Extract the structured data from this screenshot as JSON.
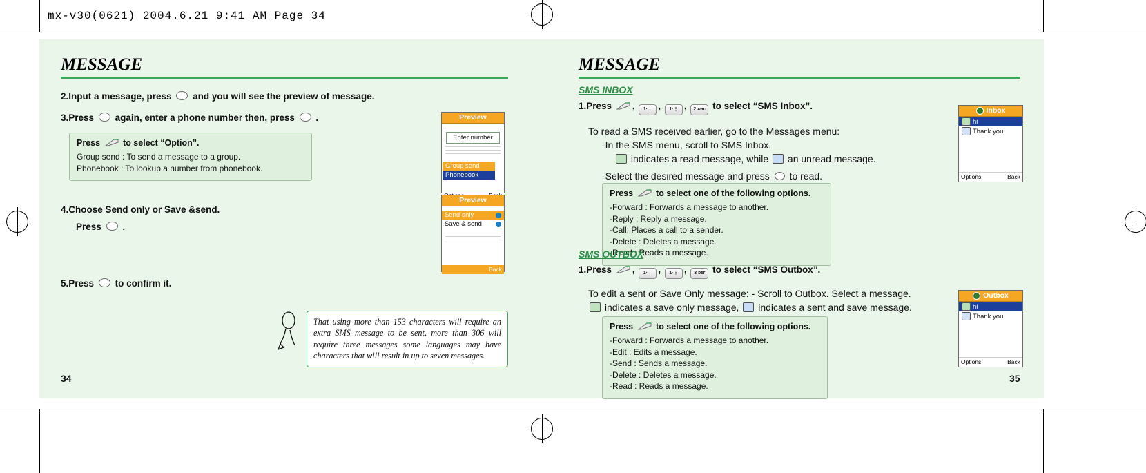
{
  "header": {
    "filestamp": "mx-v30(0621)  2004.6.21  9:41 AM  Page 34"
  },
  "left_page": {
    "title": "MESSAGE",
    "page_number": "34",
    "steps": [
      {
        "id": "step2",
        "text_before": "2.Input a message, press",
        "text_after": "and you will see the preview of message."
      },
      {
        "id": "step3",
        "text_before": "3.Press",
        "text_mid": "again, enter a phone number then, press",
        "text_after": "."
      }
    ],
    "option_box": {
      "press_label": "Press",
      "press_suffix": "to select “Option”.",
      "lines": [
        "Group send : To send a message to a group.",
        "Phonebook : To lookup a number from phonebook."
      ]
    },
    "step4": {
      "line1": "4.Choose Send only or Save &send.",
      "line2": "Press",
      "line2_after": "."
    },
    "step5": {
      "before": "5.Press",
      "after": "to confirm it."
    },
    "tip": "That using more than 153 characters will require an extra SMS message to be sent, more than 306 will require three messages some languages may have characters that will result in up to seven messages.",
    "phone1": {
      "title": "Preview",
      "field_label": "Enter number",
      "highlight_orange": "Group send",
      "highlight_blue": "Phonebook",
      "left_soft": "Options",
      "right_soft": "Back"
    },
    "phone2": {
      "title": "Preview",
      "item1": "Send only",
      "item2": "Save & send",
      "left_soft": "",
      "right_soft": "Back"
    }
  },
  "right_page": {
    "title": "MESSAGE",
    "page_number": "35",
    "inbox": {
      "heading": "SMS INBOX",
      "step_prefix": "1.Press",
      "keys": [
        "1·⋮",
        "1·⋮",
        "2 ᴀᴃᴄ"
      ],
      "step_suffix": "to select “SMS Inbox”.",
      "body_line1": "To read a SMS received earlier, go to the Messages menu:",
      "body_line2": "-In the SMS menu, scroll to SMS Inbox.",
      "body_line3_a": "indicates a read message, while",
      "body_line3_b": "an unread message.",
      "body_line4_a": "-Select the desired message and press",
      "body_line4_b": "to read.",
      "options": {
        "press_label": "Press",
        "press_suffix": "to select one of the following options.",
        "lines": [
          "-Forward : Forwards a message to another.",
          "-Reply : Reply a message.",
          "-Call: Places a call to a sender.",
          "-Delete : Deletes a message.",
          "-Read : Reads a message."
        ]
      },
      "phone": {
        "title": "Inbox",
        "row1": "hi",
        "row2": "Thank you",
        "left_soft": "Options",
        "right_soft": "Back"
      }
    },
    "outbox": {
      "heading": "SMS OUTBOX",
      "step_prefix": "1.Press",
      "keys": [
        "1·⋮",
        "1·⋮",
        "3 ᴅᴇғ"
      ],
      "step_suffix": "to select “SMS Outbox”.",
      "body_line1": "To edit a sent or Save Only message: - Scroll to Outbox. Select a message.",
      "body_line2_a": "indicates a save only message,",
      "body_line2_b": "indicates a sent and save message.",
      "options": {
        "press_label": "Press",
        "press_suffix": "to select one of the following options.",
        "lines": [
          "-Forward : Forwards a message to another.",
          "-Edit : Edits a message.",
          "-Send : Sends a message.",
          "-Delete : Deletes a message.",
          "-Read : Reads a message."
        ]
      },
      "phone": {
        "title": "Outbox",
        "row1": "hi",
        "row2": "Thank you",
        "left_soft": "Options",
        "right_soft": "Back"
      }
    }
  },
  "colors": {
    "green_rule": "#3aa85a",
    "heading_green": "#2a8f45",
    "panel_bg": "#eaf6ea",
    "orange": "#f5a623",
    "blue_hl": "#1b3f9b"
  }
}
